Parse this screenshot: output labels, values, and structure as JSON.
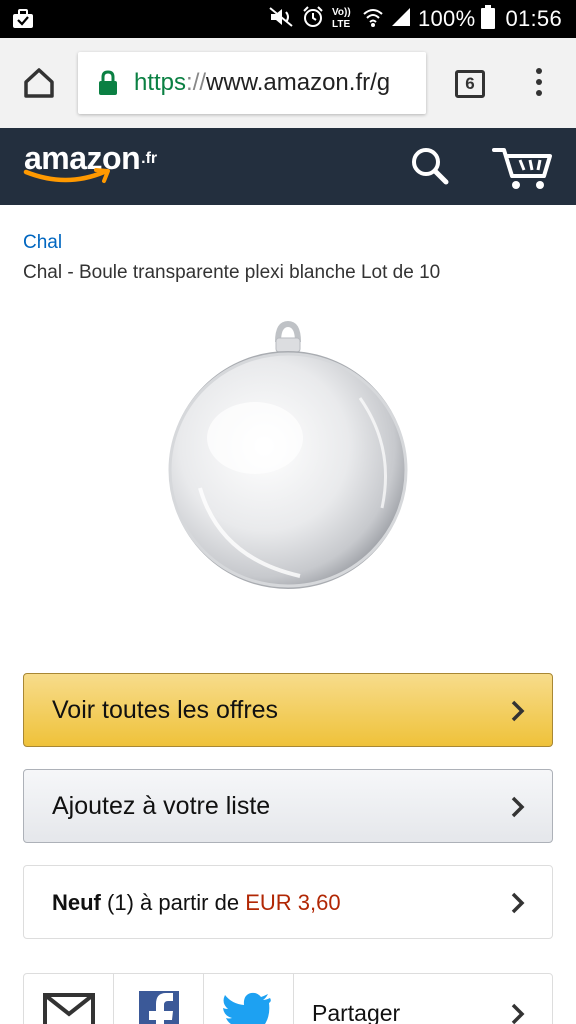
{
  "status_bar": {
    "battery_text": "100%",
    "time": "01:56",
    "lte_label": "Vo)) LTE"
  },
  "browser": {
    "url_scheme": "https",
    "url_separator": "://",
    "url_host": "www.amazon.fr/g",
    "tab_count": "6"
  },
  "header": {
    "logo_text": "amazon",
    "logo_tld": ".fr",
    "brand_color": "#232f3e",
    "accent_color": "#ff9900"
  },
  "product": {
    "brand": "Chal",
    "title": "Chal - Boule transparente plexi blanche Lot de 10"
  },
  "actions": {
    "offers_label": "Voir toutes les offres",
    "list_label": "Ajoutez à votre liste",
    "new_condition": "Neuf",
    "new_count": "(1)",
    "new_from": "à partir de",
    "new_price": "EUR 3,60"
  },
  "share": {
    "label": "Partager",
    "icons": [
      "email-icon",
      "facebook-icon",
      "twitter-icon"
    ]
  }
}
